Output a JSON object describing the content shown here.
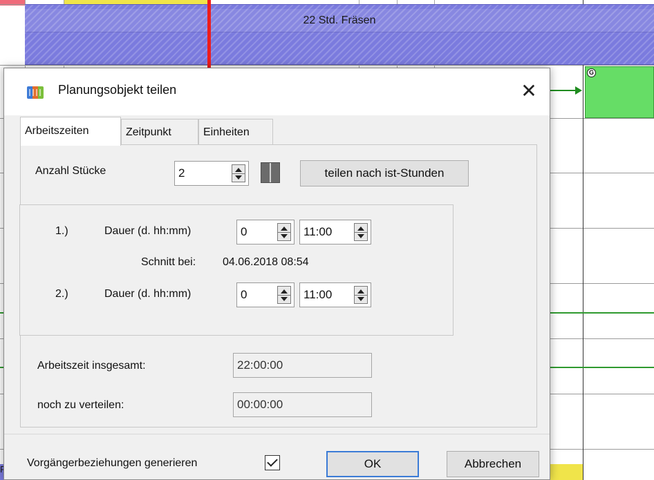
{
  "background": {
    "task_bar_label": "22 Std. Fräsen",
    "green_badge": "G",
    "bottom_left_fragment": "Pr",
    "colors": {
      "task_bar": "#7b7bde",
      "green_task": "#66dd66",
      "now_line": "#ee1c1c",
      "dependency": "#1f8c1f",
      "yellow_task": "#f0e44a"
    }
  },
  "dialog": {
    "icon": "planning-app-icon",
    "title": "Planungsobjekt teilen",
    "close_symbol": "✕",
    "tabs": [
      {
        "label": "Arbeitszeiten",
        "active": true
      },
      {
        "label": "Zeitpunkt",
        "active": false
      },
      {
        "label": "Einheiten",
        "active": false
      }
    ],
    "pieces": {
      "label": "Anzahl Stücke",
      "value": "2",
      "split_icon": "split-columns-icon",
      "split_button": "teilen nach ist-Stunden"
    },
    "parts": [
      {
        "index": "1.)",
        "duration_label": "Dauer (d. hh:mm)",
        "days": "0",
        "time": "11:00"
      },
      {
        "index": "2.)",
        "duration_label": "Dauer (d. hh:mm)",
        "days": "0",
        "time": "11:00"
      }
    ],
    "cut": {
      "label": "Schnitt bei:",
      "value": "04.06.2018 08:54"
    },
    "total": {
      "label": "Arbeitszeit insgesamt:",
      "value": "22:00:00"
    },
    "remaining": {
      "label": "noch zu verteilen:",
      "value": "00:00:00"
    },
    "footer": {
      "checkbox_label": "Vorgängerbeziehungen generieren",
      "checkbox_checked": true,
      "ok_label": "OK",
      "cancel_label": "Abbrechen"
    }
  }
}
